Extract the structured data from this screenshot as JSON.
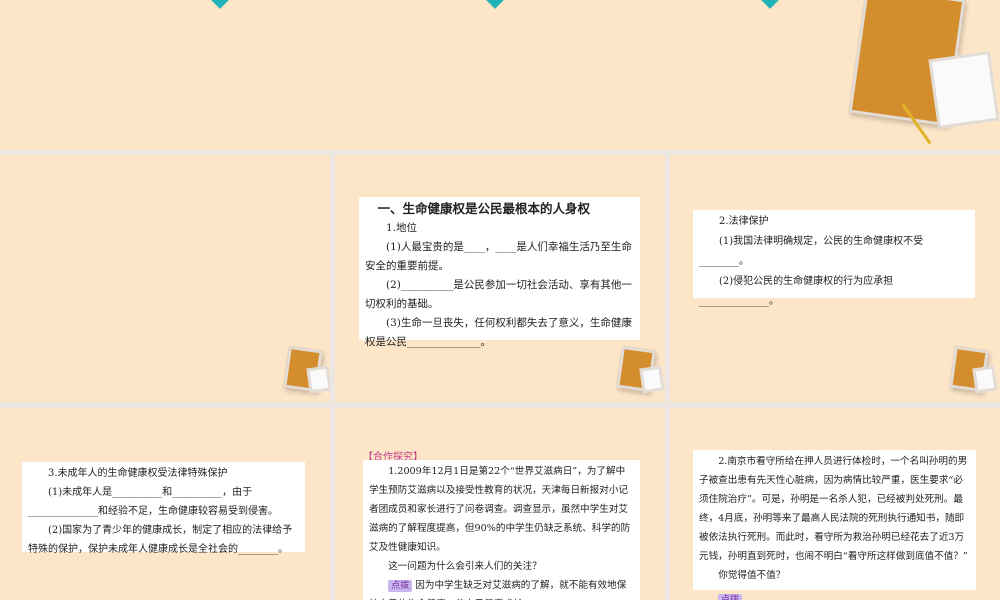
{
  "slides": [
    {
      "id": "top"
    },
    {
      "id": "blank"
    },
    {
      "heading": "一、生命健康权是公民最根本的人身权",
      "sub": "1.地位",
      "lines": [
        "(1)人最宝贵的是____，____是人们幸福生活乃至生命安全的重要前提。",
        "(2)__________是公民参加一切社会活动、享有其他一切权利的基础。",
        "(3)生命一旦丧失，任何权利都失去了意义，生命健康权是公民______________。"
      ]
    },
    {
      "sub": "2.法律保护",
      "lines": [
        "(1)我国法律明确规定，公民的生命健康权不受________。",
        "(2)侵犯公民的生命健康权的行为应承担______________。"
      ]
    },
    {
      "sub": "3.未成年人的生命健康权受法律特殊保护",
      "lines": [
        "(1)未成年人是__________和__________，由于______________和经验不足，生命健康较容易受到侵害。",
        "(2)国家为了青少年的健康成长，制定了相应的法律给予特殊的保护，保护未成年人健康成长是全社会的________。"
      ]
    },
    {
      "tag": "【合作探究】",
      "lines": [
        "1.2009年12月1日是第22个“世界艾滋病日”，为了解中学生预防艾滋病以及接受性教育的状况，天津每日新报对小记者团成员和家长进行了问卷调查。调查显示，虽然中学生对艾滋病的了解程度提高，但90%的中学生仍缺乏系统、科学的防艾及性健康知识。",
        "这一问题为什么会引来人们的关注？"
      ],
      "hint": "点拨",
      "answer": "因为中学生缺乏对艾滋病的了解，就不能有效地保护自己的生命健康，使自己健康成长。"
    },
    {
      "lines": [
        "2.南京市看守所给在押人员进行体检时，一个名叫孙明的男子被查出患有先天性心脏病，因为病情比较严重，医生要求“必须住院治疗”。可是，孙明是一名杀人犯，已经被判处死刑。最终，4月底，孙明等来了最高人民法院的死刑执行通知书，随即被依法执行死刑。而此时，看守所为救治孙明已经花去了近3万元钱，孙明直到死时，也闹不明白“看守所这样做到底值不值？”",
        "你觉得值不值？"
      ],
      "hint": "点拨"
    }
  ],
  "colors": {
    "background": "#fde6c8",
    "gap": "#ebe6e1",
    "accent": "#1fb3b8"
  }
}
